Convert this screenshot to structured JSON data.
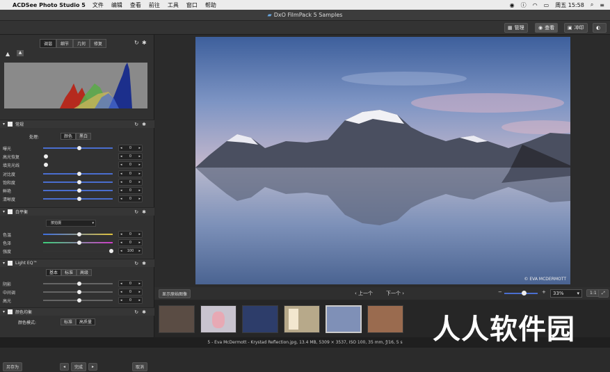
{
  "menubar": {
    "app": "ACDSee Photo Studio 5",
    "items": [
      "文件",
      "编辑",
      "查看",
      "前往",
      "工具",
      "窗口",
      "帮助"
    ],
    "clock": "周五 15:58"
  },
  "window": {
    "title": "DxO FilmPack 5 Samples"
  },
  "toolbar": {
    "manage": "管理",
    "view": "查看",
    "develop": "冲印"
  },
  "panel": {
    "tabs": [
      "调谐",
      "细节",
      "几何",
      "修复"
    ],
    "general": {
      "title": "常规",
      "process_label": "处理:",
      "process_options": [
        "颜色",
        "黑白"
      ],
      "sliders": [
        {
          "label": "曝光",
          "value": "0"
        },
        {
          "label": "高光恢复",
          "value": "0"
        },
        {
          "label": "填充光线",
          "value": "0"
        },
        {
          "label": "对比度",
          "value": "0"
        },
        {
          "label": "饱和度",
          "value": "0"
        },
        {
          "label": "鲜艳",
          "value": "0"
        },
        {
          "label": "清晰度",
          "value": "0"
        }
      ]
    },
    "wb": {
      "title": "白平衡",
      "preset": "按拍摄",
      "sliders": [
        {
          "label": "色温",
          "value": "0"
        },
        {
          "label": "色泽",
          "value": "0"
        },
        {
          "label": "强度",
          "value": "100"
        }
      ]
    },
    "lighteq": {
      "title": "Light EQ™",
      "modes": [
        "基本",
        "标准",
        "高级"
      ],
      "sliders": [
        {
          "label": "阴影",
          "value": "0"
        },
        {
          "label": "中间调",
          "value": "0"
        },
        {
          "label": "高光",
          "value": "0"
        }
      ]
    },
    "colorbal": {
      "title": "颜色均衡",
      "mode_label": "颜色模式:",
      "modes": [
        "标准",
        "高质量"
      ]
    },
    "save_as": "另存为",
    "done": "完成",
    "cancel": "取消"
  },
  "photo": {
    "credit": "© EVA MCDERMOTT"
  },
  "nav": {
    "show_original": "显示原始图像",
    "prev": "上一个",
    "next": "下一个",
    "zoom": "33%",
    "one_to_one": "1:1"
  },
  "status": {
    "text": "5 - Eva McDermott - Krystad Reflection.jpg, 13.4 MB, 5309 × 3537, ISO 100, 35 mm, ƒ/16, 5 s"
  },
  "watermark": "人人软件园",
  "colors": {
    "accent": "#4a6ed0",
    "bg": "#2b2b2b"
  }
}
